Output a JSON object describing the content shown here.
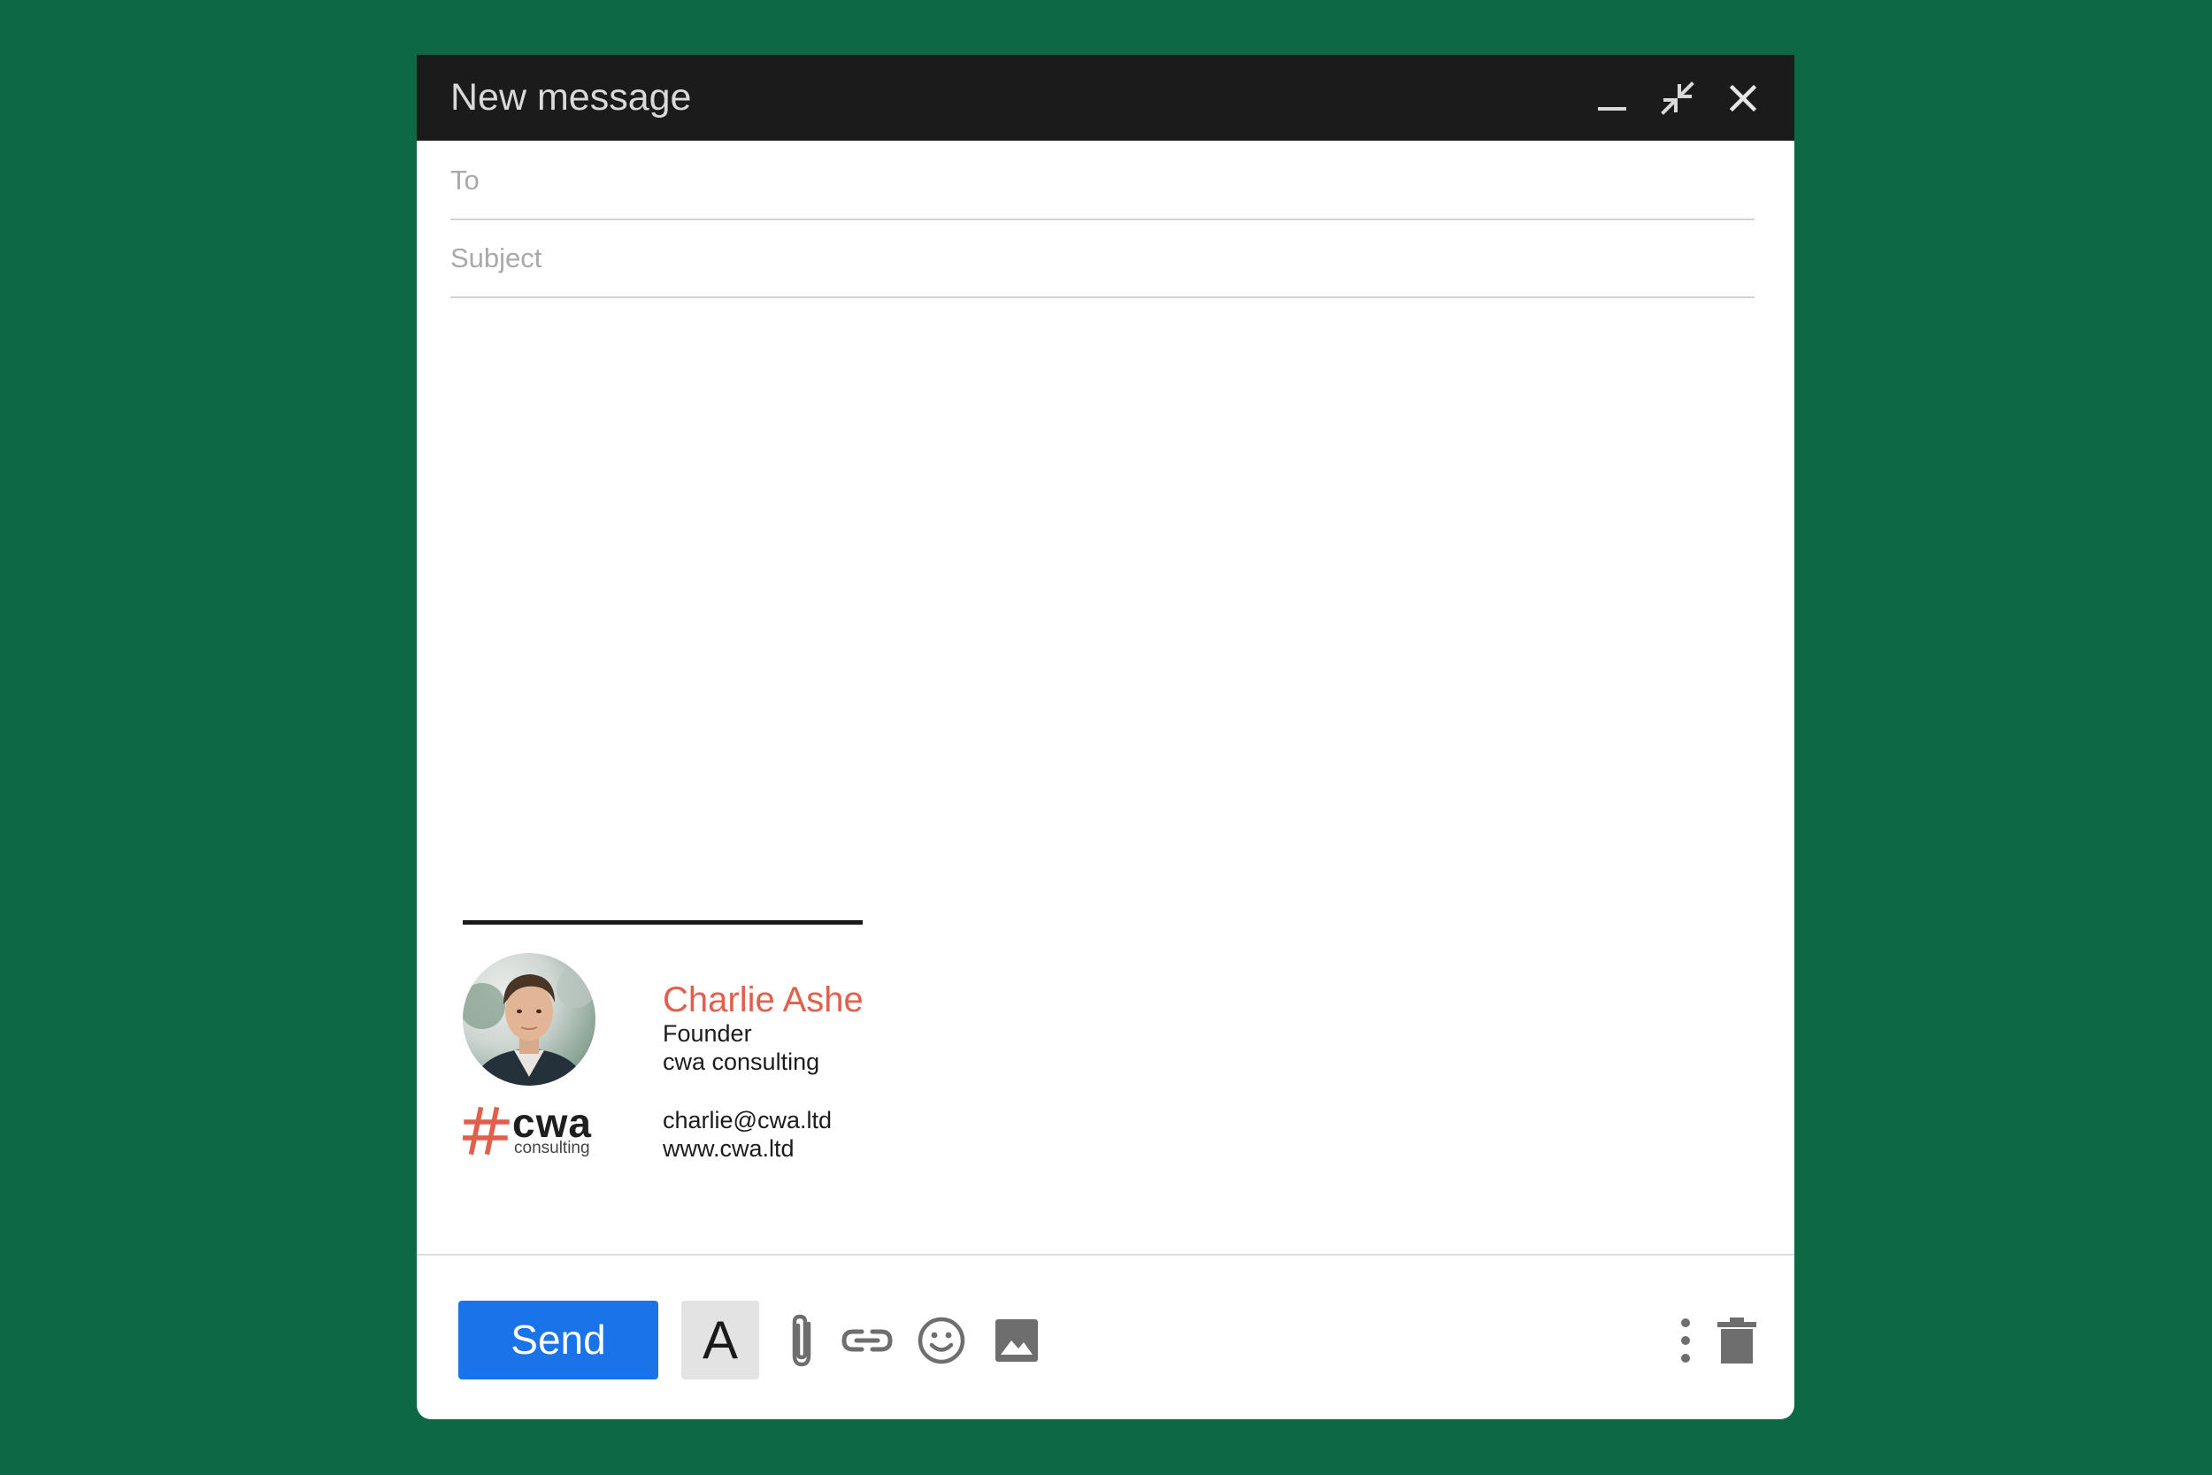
{
  "window": {
    "title": "New message",
    "controls": {
      "minimize": "minimize-icon",
      "exit_fullscreen": "exit-fullscreen-icon",
      "close": "close-icon"
    }
  },
  "fields": {
    "to": {
      "placeholder": "To",
      "value": ""
    },
    "subject": {
      "placeholder": "Subject",
      "value": ""
    }
  },
  "signature": {
    "name": "Charlie Ashe",
    "role": "Founder",
    "company": "cwa consulting",
    "email": "charlie@cwa.ltd",
    "website": "www.cwa.ltd",
    "logo": {
      "word": "cwa",
      "subtitle": "consulting"
    }
  },
  "toolbar": {
    "send_label": "Send",
    "format_label": "A",
    "icons": [
      "format-text-icon",
      "paperclip-icon",
      "link-icon",
      "emoji-icon",
      "image-icon",
      "more-vert-icon",
      "trash-icon"
    ]
  },
  "colors": {
    "background": "#0d6845",
    "titlebar": "#1b1b1b",
    "send_button": "#1a73e8",
    "signature_name": "#e0604c",
    "logo_accent": "#e0604c"
  }
}
